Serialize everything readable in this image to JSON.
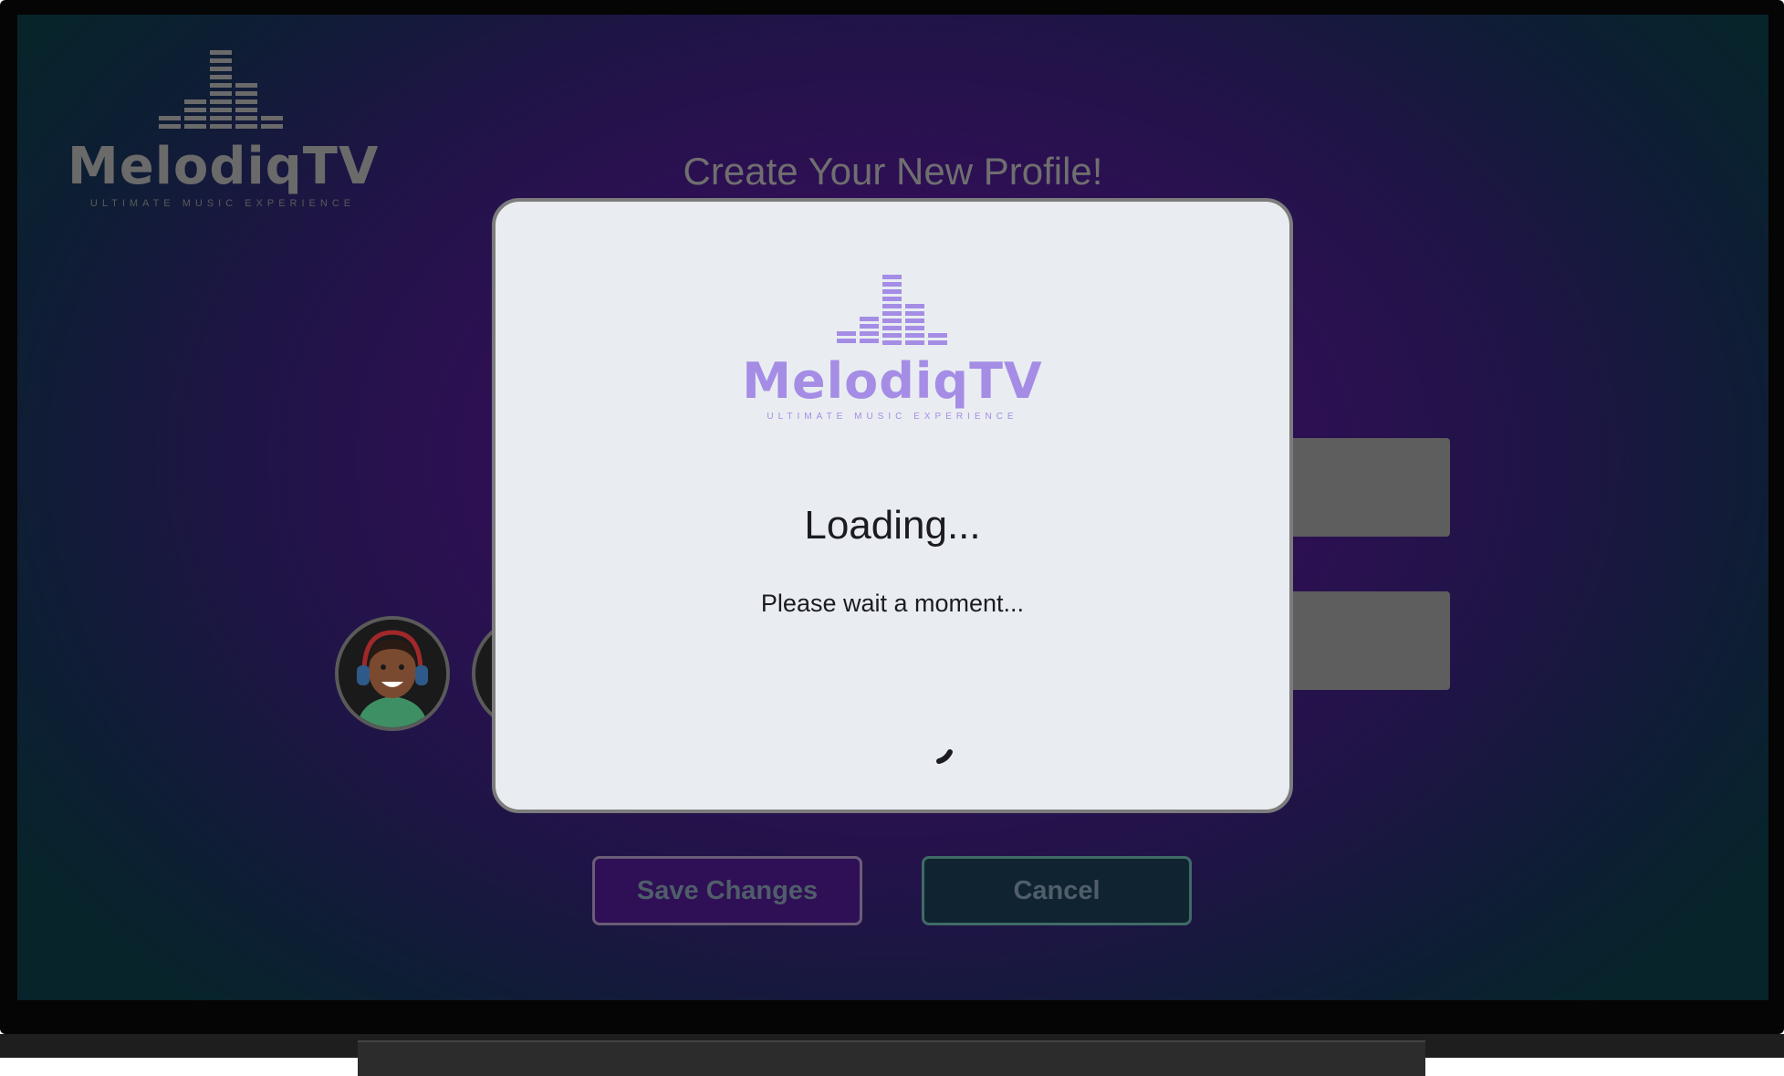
{
  "app": {
    "brand_name": "MelodiqTV",
    "brand_tagline": "ULTIMATE MUSIC EXPERIENCE"
  },
  "page": {
    "title": "Create Your New Profile!"
  },
  "actions": {
    "save_label": "Save Changes",
    "cancel_label": "Cancel"
  },
  "loading_dialog": {
    "brand_name": "MelodiqTV",
    "brand_tagline": "ULTIMATE MUSIC EXPERIENCE",
    "title": "Loading...",
    "message": "Please wait a moment..."
  },
  "colors": {
    "brand_purple": "#a58de6",
    "background_purple": "#3e1260",
    "background_teal": "#07242a",
    "dialog_bg": "#e9edf1"
  },
  "icons": [
    "equalizer-logo-icon",
    "avatar-headphones-icon",
    "loading-spinner-icon"
  ]
}
